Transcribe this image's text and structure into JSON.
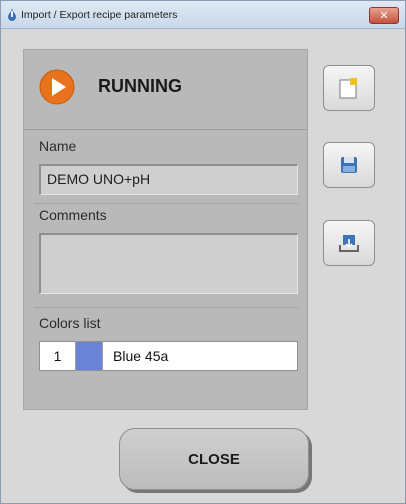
{
  "window": {
    "title": "Import / Export recipe parameters",
    "close_glyph": "✕"
  },
  "status": {
    "icon": "play-icon",
    "text": "RUNNING",
    "accent": "#e8731c"
  },
  "form": {
    "name_label": "Name",
    "name_value": "DEMO UNO+pH",
    "comments_label": "Comments",
    "comments_value": "",
    "colors_label": "Colors list",
    "colors": [
      {
        "number": "1",
        "swatch": "#6b83d4",
        "name": "Blue 45a"
      }
    ]
  },
  "side_buttons": [
    {
      "icon": "new-document-icon"
    },
    {
      "icon": "save-icon"
    },
    {
      "icon": "import-icon"
    }
  ],
  "footer": {
    "close_label": "CLOSE"
  }
}
